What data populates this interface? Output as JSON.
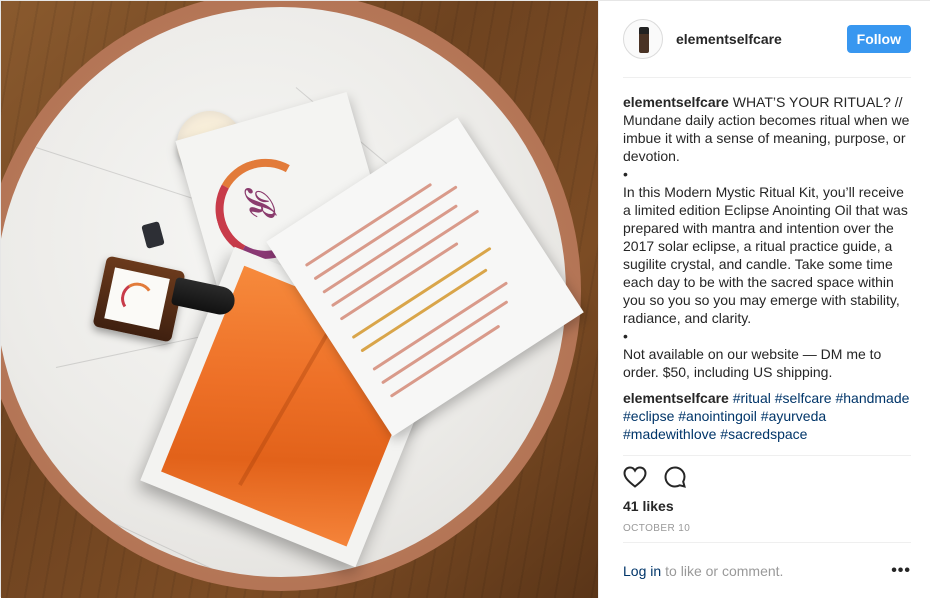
{
  "post": {
    "username": "elementselfcare",
    "follow_label": "Follow",
    "caption": {
      "username": "elementselfcare",
      "text": " WHAT’S YOUR RITUAL? // Mundane daily action becomes ritual when we imbue it with a sense of meaning, purpose, or devotion.\n•\nIn this Modern Mystic Ritual Kit, you’ll receive a limited edition Eclipse Anointing Oil that was prepared with mantra and intention over the 2017 solar eclipse, a ritual practice guide, a sugilite crystal, and candle. Take some time each day to be with the sacred space within you so you so you may emerge with stability, radiance, and clarity.\n•\nNot available on our website — DM me to order. $50, including US shipping."
    },
    "hashtag_comment": {
      "username": "elementselfcare",
      "tags": [
        "#ritual",
        "#selfcare",
        "#handmade",
        "#eclipse",
        "#anointingoil",
        "#ayurveda",
        "#madewithlove",
        "#sacredspace"
      ]
    },
    "likes": "41 likes",
    "date": "OCTOBER 10",
    "login_link": "Log in",
    "login_text": "to like or comment.",
    "more_options": "•••"
  },
  "icons": {
    "like": "heart-icon",
    "comment": "comment-icon",
    "more": "more-options-icon"
  },
  "colors": {
    "follow_button": "#3897f0",
    "link": "#003569",
    "muted": "#999999",
    "text": "#262626"
  }
}
